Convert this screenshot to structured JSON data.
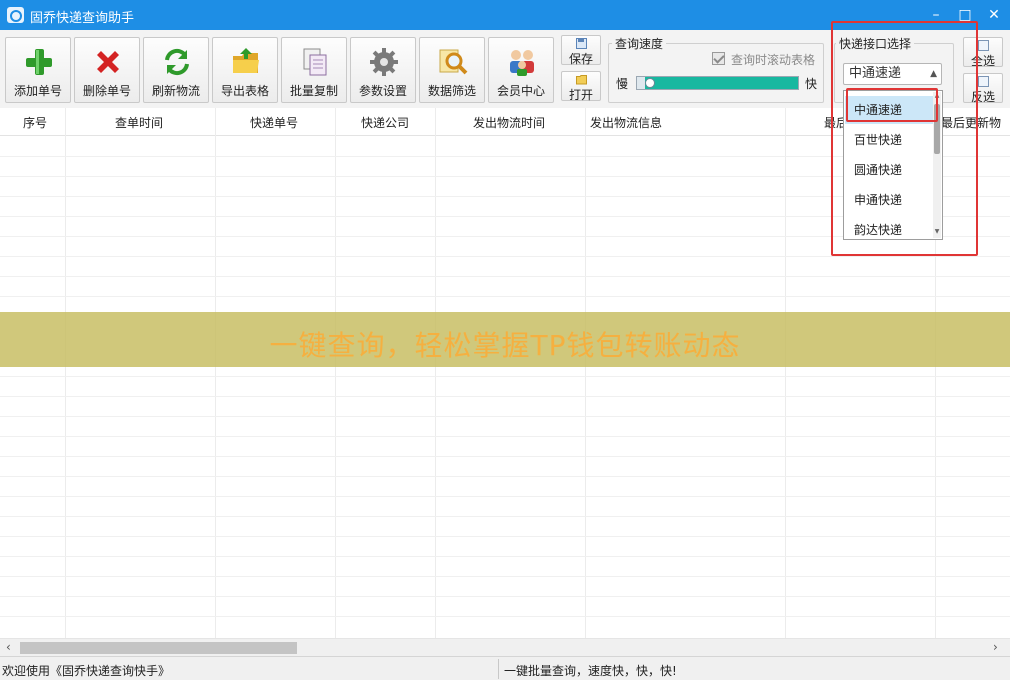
{
  "window": {
    "title": "固乔快递查询助手",
    "minimize": "–",
    "maximize": "□",
    "close": "✕"
  },
  "toolbar": {
    "buttons": [
      {
        "label": "添加单号",
        "icon": "plus-icon"
      },
      {
        "label": "删除单号",
        "icon": "delete-x-icon"
      },
      {
        "label": "刷新物流",
        "icon": "refresh-icon"
      },
      {
        "label": "导出表格",
        "icon": "export-folder-icon"
      },
      {
        "label": "批量复制",
        "icon": "copy-icon"
      },
      {
        "label": "参数设置",
        "icon": "gear-icon"
      },
      {
        "label": "数据筛选",
        "icon": "magnifier-icon"
      },
      {
        "label": "会员中心",
        "icon": "members-icon"
      }
    ],
    "save_label": "保存",
    "open_label": "打开",
    "select_all_label": "全选",
    "invert_label": "反选"
  },
  "query_speed": {
    "title": "查询速度",
    "scroll_checkbox_label": "查询时滚动表格",
    "scroll_checked": true,
    "slow_label": "慢",
    "fast_label": "快",
    "level": 0.05
  },
  "courier_select": {
    "title": "快递接口选择",
    "selected": "中通速递",
    "options": [
      "中通速递",
      "百世快递",
      "圆通快递",
      "申通快递",
      "韵达快递"
    ],
    "highlighted_index": 0
  },
  "table": {
    "columns": [
      "序号",
      "查单时间",
      "快递单号",
      "快递公司",
      "发出物流时间",
      "发出物流信息",
      "最后",
      "最后更新物"
    ]
  },
  "banner": {
    "text": "一键查询，轻松掌握TP钱包转账动态"
  },
  "status": {
    "left": "欢迎使用《固乔快递查询快手》",
    "right": "一键批量查询，速度快，快，快!"
  },
  "colors": {
    "titlebar": "#1e8ee5",
    "highlight": "#e03535",
    "progress": "#18b8a0",
    "banner": "#c8be64",
    "banner_text": "#f5b040"
  }
}
